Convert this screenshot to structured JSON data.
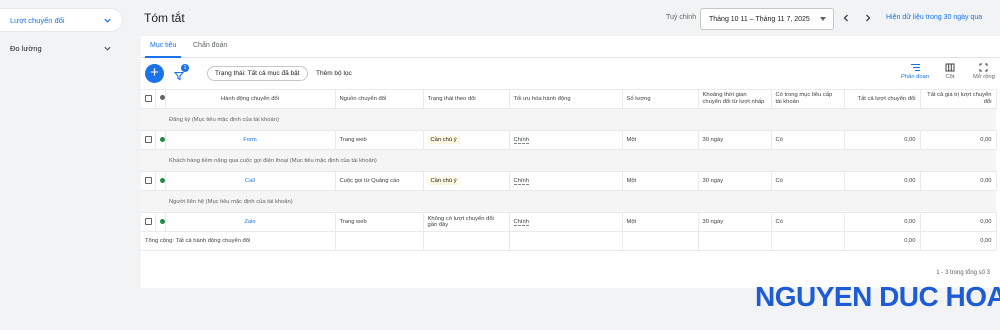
{
  "nav": {
    "items": [
      {
        "label": "Lượt chuyển đổi"
      },
      {
        "label": "Đo lường"
      }
    ]
  },
  "header": {
    "title": "Tóm tắt",
    "custom_label": "Tuỳ chỉnh",
    "date_range": "Tháng 10 11 – Tháng 11 7, 2025",
    "compare_link": "Hiện dữ liệu trong 30 ngày qua"
  },
  "tabs": [
    {
      "label": "Mục tiêu"
    },
    {
      "label": "Chẩn đoán"
    }
  ],
  "toolbar": {
    "filter_count": "1",
    "filter_chip": "Trạng thái: Tất cả mục đã bật",
    "add_filter": "Thêm bộ lọc",
    "segment_label": "Phân đoạn",
    "column_label": "Cột",
    "expand_label": "Mở rộng"
  },
  "table": {
    "headers": [
      "Hành động chuyển đổi",
      "Nguồn chuyển đổi",
      "Trạng thái theo dõi",
      "Tối ưu hóa hành động",
      "Số lượng",
      "Khoảng thời gian chuyển đổi từ lượt nhấp",
      "Có trong mục tiêu cấp tài khoản",
      "Tất cả lượt chuyển đổi",
      "Tất cả giá trị lượt chuyển đổi"
    ],
    "groups": [
      {
        "label": "Đăng ký (Mục tiêu mặc định của tài khoản)",
        "row": {
          "action": "Form",
          "source": "Trang web",
          "status": "Cần chú ý",
          "optimization": "Chính",
          "count": "Một",
          "window": "30 ngày",
          "account_goal": "Có",
          "all_conv": "0,00",
          "all_value": "0,00"
        }
      },
      {
        "label": "Khách hàng tiềm năng qua cuộc gọi điện thoại (Mục tiêu mặc định của tài khoản)",
        "row": {
          "action": "Call",
          "source": "Cuộc gọi từ Quảng cáo",
          "status": "Cần chú ý",
          "optimization": "Chính",
          "count": "Một",
          "window": "30 ngày",
          "account_goal": "Có",
          "all_conv": "0,00",
          "all_value": "0,00"
        }
      },
      {
        "label": "Người liên hệ (Mục tiêu mặc định của tài khoản)",
        "row": {
          "action": "Zalo",
          "source": "Trang web",
          "status": "Không có lượt chuyển đổi gần đây",
          "optimization": "Chính",
          "count": "Một",
          "window": "30 ngày",
          "account_goal": "Có",
          "all_conv": "0,00",
          "all_value": "0,00"
        }
      }
    ],
    "total": {
      "label": "Tổng cộng: Tất cả hành động chuyển đổi",
      "all_conv": "0,00",
      "all_value": "0,00"
    },
    "pagination": "1 - 3 trong tổng số 3"
  },
  "colors": {
    "accent": "#1a73e8",
    "status_dot": "#1e8e3e",
    "warn_bg": "#fef7e0"
  },
  "watermark": "NGUYEN DUC HOA"
}
